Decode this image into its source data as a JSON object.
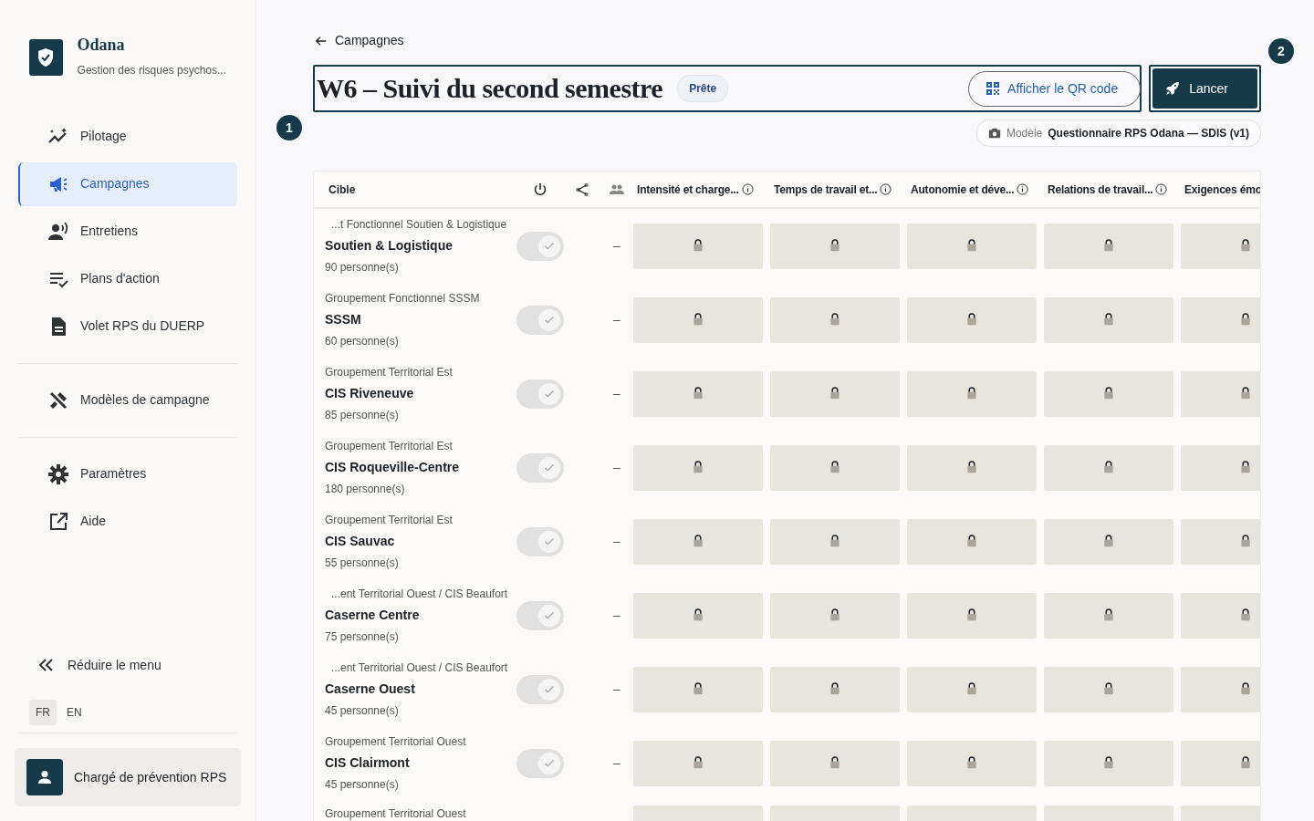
{
  "brand": {
    "name": "Odana",
    "tagline": "Gestion des risques psychos..."
  },
  "sidebar": {
    "sections": [
      {
        "items": [
          {
            "label": "Pilotage",
            "selected": false
          },
          {
            "label": "Campagnes",
            "selected": true
          },
          {
            "label": "Entretiens",
            "selected": false
          },
          {
            "label": "Plans d'action",
            "selected": false
          },
          {
            "label": "Volet RPS du DUERP",
            "selected": false
          }
        ]
      },
      {
        "items": [
          {
            "label": "Modèles de campagne",
            "selected": false
          }
        ]
      },
      {
        "items": [
          {
            "label": "Paramètres",
            "selected": false
          },
          {
            "label": "Aide",
            "selected": false
          }
        ]
      }
    ],
    "collapse": "Réduire le menu",
    "languages": [
      {
        "label": "FR",
        "selected": true
      },
      {
        "label": "EN",
        "selected": false
      }
    ],
    "user": "Chargé de prévention RPS"
  },
  "breadcrumb": "Campagnes",
  "title": "W6 – Suivi du second semestre",
  "status": "Prête",
  "qr_button": "Afficher le QR code",
  "launch_button": "Lancer",
  "callouts": [
    "1",
    "2"
  ],
  "model": {
    "label": "Modèle",
    "value": "Questionnaire RPS Odana — SDIS (v1)"
  },
  "table": {
    "columns": [
      "Cible",
      "Intensité et charge...",
      "Temps de travail et...",
      "Autonomie et déve...",
      "Relations de travail...",
      "Exigences émo"
    ],
    "rows": [
      {
        "group": "...t Fonctionnel Soutien & Logistique",
        "name": "Soutien & Logistique",
        "count": "90 personne(s)",
        "on": true,
        "disabled": true,
        "people": "–"
      },
      {
        "group": "Groupement Fonctionnel SSSM",
        "name": "SSSM",
        "count": "60 personne(s)",
        "on": true,
        "disabled": true,
        "people": "–"
      },
      {
        "group": "Groupement Territorial Est",
        "name": "CIS Riveneuve",
        "count": "85 personne(s)",
        "on": true,
        "disabled": true,
        "people": "–"
      },
      {
        "group": "Groupement Territorial Est",
        "name": "CIS Roqueville-Centre",
        "count": "180 personne(s)",
        "on": true,
        "disabled": true,
        "people": "–"
      },
      {
        "group": "Groupement Territorial Est",
        "name": "CIS Sauvac",
        "count": "55 personne(s)",
        "on": true,
        "disabled": true,
        "people": "–"
      },
      {
        "group": "...ent Territorial Ouest / CIS Beaufort",
        "name": "Caserne Centre",
        "count": "75 personne(s)",
        "on": true,
        "disabled": true,
        "people": "–"
      },
      {
        "group": "...ent Territorial Ouest / CIS Beaufort",
        "name": "Caserne Ouest",
        "count": "45 personne(s)",
        "on": true,
        "disabled": true,
        "people": "–"
      },
      {
        "group": "Groupement Territorial Ouest",
        "name": "CIS Clairmont",
        "count": "45 personne(s)",
        "on": true,
        "disabled": true,
        "people": "–"
      },
      {
        "group": "Groupement Territorial Ouest"
      }
    ]
  }
}
